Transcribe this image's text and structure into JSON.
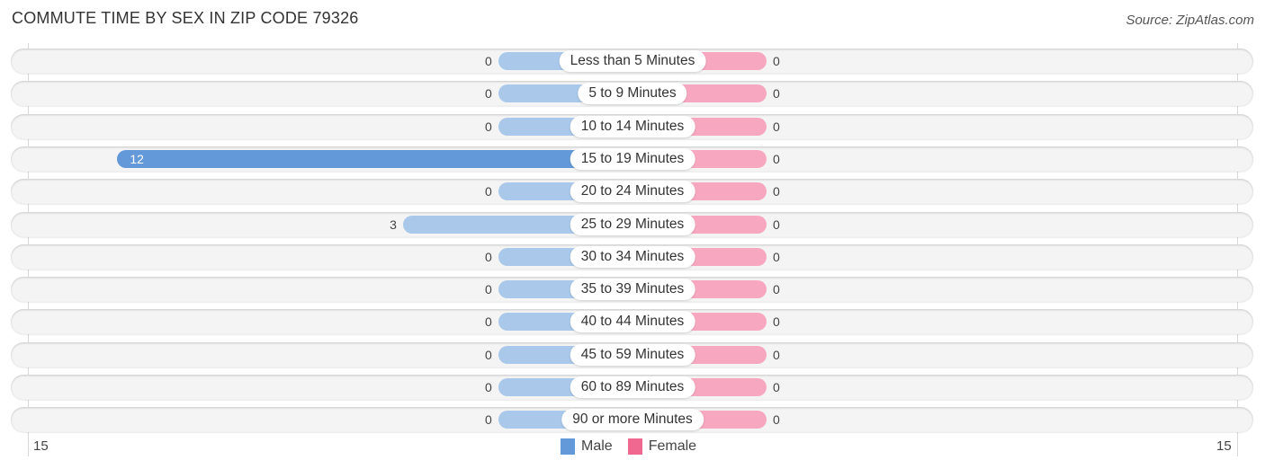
{
  "header": {
    "title": "COMMUTE TIME BY SEX IN ZIP CODE 79326",
    "source": "Source: ZipAtlas.com"
  },
  "colors": {
    "male_strong": "#6399d8",
    "male_light": "#a9c8ea",
    "female_strong": "#f06890",
    "female_light": "#f7a8c0",
    "row_bg": "#f4f4f4"
  },
  "chart_data": {
    "type": "bar",
    "orientation": "horizontal-diverging",
    "title": "COMMUTE TIME BY SEX IN ZIP CODE 79326",
    "categories": [
      "Less than 5 Minutes",
      "5 to 9 Minutes",
      "10 to 14 Minutes",
      "15 to 19 Minutes",
      "20 to 24 Minutes",
      "25 to 29 Minutes",
      "30 to 34 Minutes",
      "35 to 39 Minutes",
      "40 to 44 Minutes",
      "45 to 59 Minutes",
      "60 to 89 Minutes",
      "90 or more Minutes"
    ],
    "series": [
      {
        "name": "Male",
        "values": [
          0,
          0,
          0,
          12,
          0,
          3,
          0,
          0,
          0,
          0,
          0,
          0
        ]
      },
      {
        "name": "Female",
        "values": [
          0,
          0,
          0,
          0,
          0,
          0,
          0,
          0,
          0,
          0,
          0,
          0
        ]
      }
    ],
    "axis": {
      "left_tick": "15",
      "right_tick": "15",
      "max": 15
    },
    "legend": {
      "position": "bottom-center",
      "items": [
        "Male",
        "Female"
      ]
    }
  }
}
